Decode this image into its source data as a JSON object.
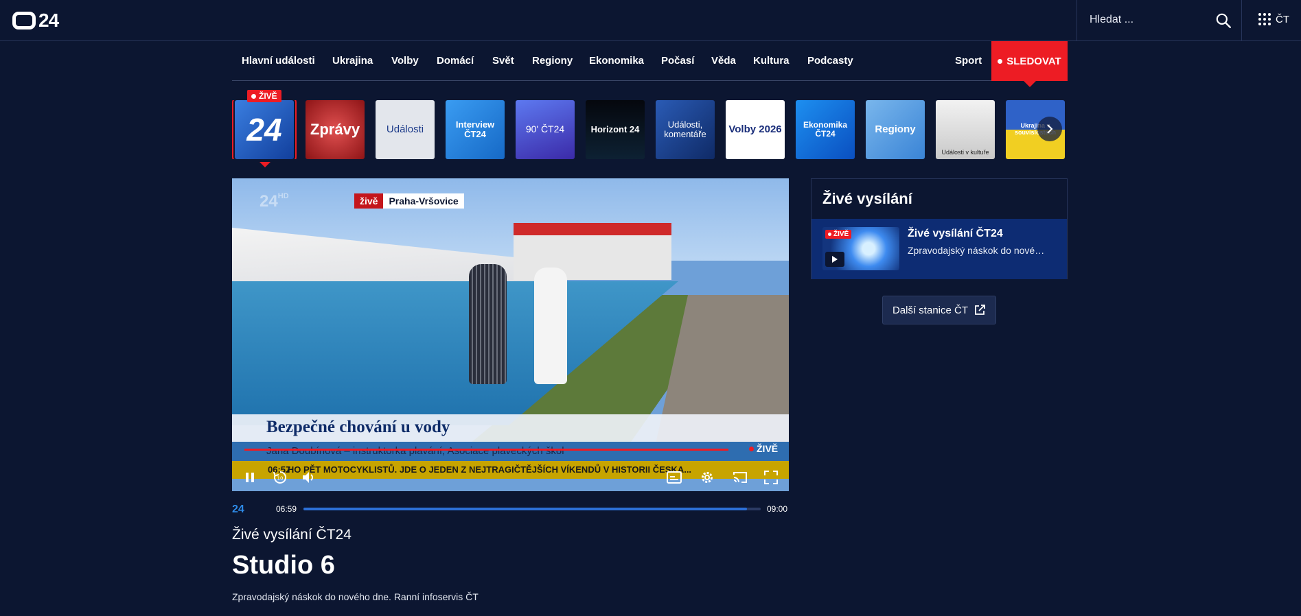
{
  "header": {
    "logo_text": "24",
    "search_placeholder": "Hledat ...",
    "apps_label": "ČT"
  },
  "nav": {
    "items": [
      "Hlavní události",
      "Ukrajina",
      "Volby",
      "Domácí",
      "Svět",
      "Regiony",
      "Ekonomika",
      "Počasí",
      "Věda",
      "Kultura",
      "Podcasty"
    ],
    "sport": "Sport",
    "follow": "SLEDOVAT"
  },
  "channels": {
    "live_badge": "ŽIVĚ",
    "items": [
      "24",
      "Zprávy",
      "Události",
      "Interview ČT24",
      "90' ČT24",
      "Horizont 24",
      "Události, komentáře",
      "Volby 2026",
      "Ekonomika ČT24",
      "Regiony",
      "Události v kultuře",
      "Ukrajina v souvislostech"
    ]
  },
  "player": {
    "watermark": "24",
    "watermark_hd": "HD",
    "location_live": "živě",
    "location": "Praha-Vršovice",
    "headline": "Bezpečné chování u vody",
    "caption": "Jana Doubínová – instruktorka plavání, Asociace plaveckých škol",
    "ticker_time": "06:57",
    "ticker": "...HO PĚT MOTOCYKLISTŮ. JDE O JEDEN Z NEJTRAGIČTĚJŠÍCH VÍKENDŮ V HISTORII ČESKA...",
    "live_label": "ŽIVĚ"
  },
  "program": {
    "channel": "24",
    "start": "06:59",
    "end": "09:00",
    "progress_fraction": 0.97,
    "subtitle": "Živé vysílání ČT24",
    "title": "Studio 6",
    "description": "Zpravodajský náskok do nového dne. Ranní infoservis ČT"
  },
  "side": {
    "heading": "Živé vysílání",
    "badge": "ŽIVĚ",
    "card_title": "Živé vysílání ČT24",
    "card_desc": "Zpravodajský náskok do nové…",
    "more_button": "Další stanice ČT"
  },
  "colors": {
    "background": "#0c1631",
    "accent_red": "#ed1c24",
    "live_card": "#0d2c73",
    "progress_blue": "#2c6fd7"
  }
}
